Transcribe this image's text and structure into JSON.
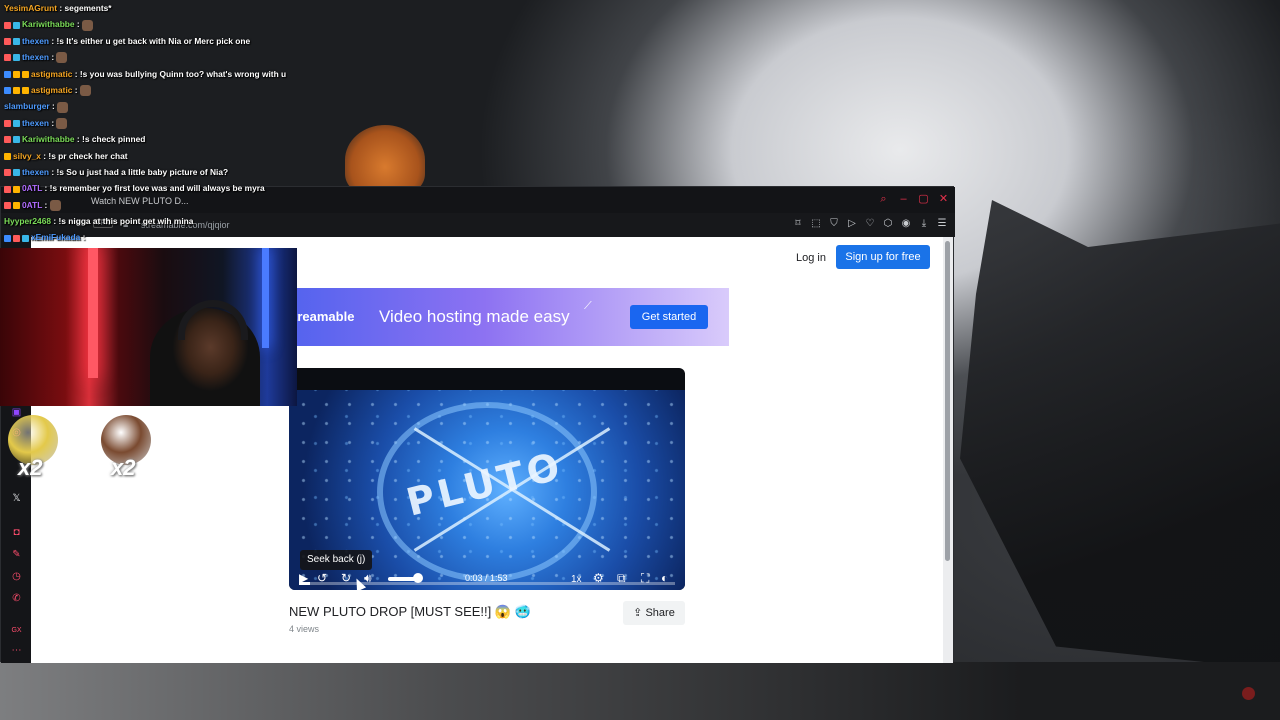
{
  "chat": {
    "messages": [
      {
        "user": "YesimAGrunt",
        "text": "segements*",
        "user_color": "#f5a623",
        "badges": []
      },
      {
        "user": "Kariwithabbe",
        "text": "",
        "user_color": "#7bdc59",
        "badges": [
          "#ff5a5a",
          "#39b7e8"
        ],
        "emote": true
      },
      {
        "user": "thexen",
        "text": "!s It's either u get back with Nia or Merc pick one",
        "user_color": "#4e9bff",
        "badges": [
          "#ff5a5a",
          "#39b7e8"
        ]
      },
      {
        "user": "thexen",
        "text": "",
        "user_color": "#4e9bff",
        "badges": [
          "#ff5a5a",
          "#39b7e8"
        ],
        "emote": true
      },
      {
        "user": "astigmatic",
        "text": "!s you was bullying Quinn too? what's wrong with u",
        "user_color": "#f5a623",
        "badges": [
          "#3c8cff",
          "#ffb400",
          "#ffb400"
        ]
      },
      {
        "user": "astigmatic",
        "text": "",
        "user_color": "#f5a623",
        "badges": [
          "#3c8cff",
          "#ffb400",
          "#ffb400"
        ],
        "emote": true
      },
      {
        "user": "slamburger",
        "text": "",
        "user_color": "#4e9bff",
        "badges": [],
        "emote": true
      },
      {
        "user": "thexen",
        "text": "",
        "user_color": "#4e9bff",
        "badges": [
          "#ff5a5a",
          "#39b7e8"
        ],
        "emote": true
      },
      {
        "user": "Kariwithabbe",
        "text": "!s check pinned",
        "user_color": "#7bdc59",
        "badges": [
          "#ff5a5a",
          "#39b7e8"
        ]
      },
      {
        "user": "silvy_x",
        "text": "!s pr check her chat",
        "user_color": "#f5a623",
        "badges": [
          "#ffb400"
        ]
      },
      {
        "user": "thexen",
        "text": "!s So u just had a little baby picture of Nia?",
        "user_color": "#4e9bff",
        "badges": [
          "#ff5a5a",
          "#39b7e8"
        ]
      },
      {
        "user": "0ATL",
        "text": "!s remember yo first love was and will always be myra",
        "user_color": "#b06cff",
        "badges": [
          "#ff5a5a",
          "#ffb400"
        ]
      },
      {
        "user": "0ATL",
        "text": "",
        "user_color": "#b06cff",
        "badges": [
          "#ff5a5a",
          "#ffb400"
        ],
        "emote": true
      },
      {
        "user": "Hyyper2468",
        "text": "!s nigga at this point get wih mina",
        "user_color": "#7bdc59",
        "badges": []
      },
      {
        "user": "xEmiFukada",
        "text": "",
        "user_color": "#4e9bff",
        "badges": [
          "#3c8cff",
          "#ff5a5a",
          "#39b7e8"
        ]
      }
    ]
  },
  "browser": {
    "tab_title": "Watch NEW PLUTO D...",
    "url": "streamable.com/qjqior",
    "vpn_label": "VPN",
    "accent": "#e4314b"
  },
  "streamable": {
    "login_label": "Log in",
    "signup_label": "Sign up for free",
    "banner": {
      "logo_text": "treamable",
      "headline": "Video hosting made easy",
      "cta_label": "Get started"
    },
    "player": {
      "video_text": "PLUTO",
      "tooltip": "Seek back (j)",
      "time": "0:03 / 1:53",
      "progress_fraction": 0.03,
      "speed": "1x"
    },
    "video_title": "NEW PLUTO DROP [MUST SEE!!] 😱 🥶",
    "views": "4 views",
    "share_label": "Share",
    "brand_blue": "#1a73e8"
  },
  "alerts": [
    {
      "count": "x2",
      "color": "#e3c94a"
    },
    {
      "count": "x2",
      "color": "#7a4a30"
    }
  ]
}
